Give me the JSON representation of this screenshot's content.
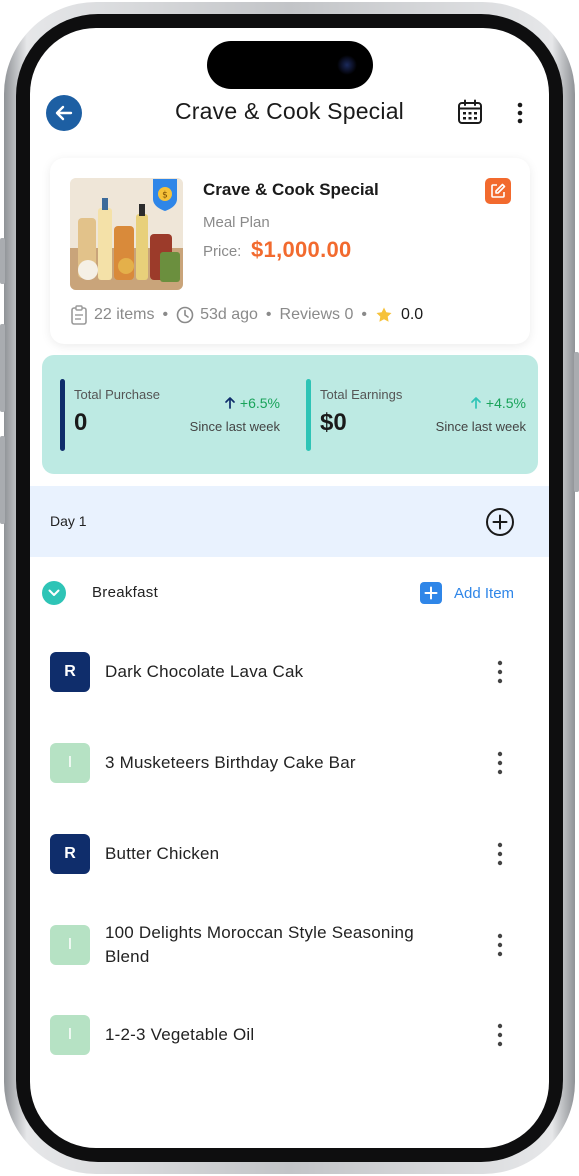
{
  "header": {
    "title": "Crave & Cook Special",
    "back_icon": "arrow-left-icon",
    "calendar_icon": "calendar-icon",
    "more_icon": "more-vertical-icon"
  },
  "product": {
    "name": "Crave & Cook Special",
    "type": "Meal Plan",
    "price_label": "Price:",
    "price": "$1,000.00",
    "items": "22 items",
    "age": "53d ago",
    "reviews": "Reviews 0",
    "rating": "0.0"
  },
  "stats": [
    {
      "label": "Total Purchase",
      "value": "0",
      "change": "+6.5%",
      "since": "Since last week",
      "bar_color": "#0f2d6b"
    },
    {
      "label": "Total Earnings",
      "value": "$0",
      "change": "+4.5%",
      "since": "Since last week",
      "bar_color": "#2ec4b6"
    }
  ],
  "day": {
    "label": "Day 1"
  },
  "meal": {
    "name": "Breakfast",
    "add_label": "Add Item"
  },
  "items": [
    {
      "initial": "R",
      "name": "Dark Chocolate Lava Cak"
    },
    {
      "initial": "I",
      "name": "3 Musketeers Birthday Cake Bar"
    },
    {
      "initial": "R",
      "name": "Butter Chicken"
    },
    {
      "initial": "I",
      "name": "100 Delights Moroccan Style Seasoning Blend"
    },
    {
      "initial": "I",
      "name": "1-2-3 Vegetable Oil"
    }
  ],
  "colors": {
    "accent_orange": "#f26a2e",
    "accent_blue": "#2f86e8",
    "stats_bg": "#bdeae3",
    "day_bg": "#e9f2fe",
    "positive": "#19a35a"
  }
}
